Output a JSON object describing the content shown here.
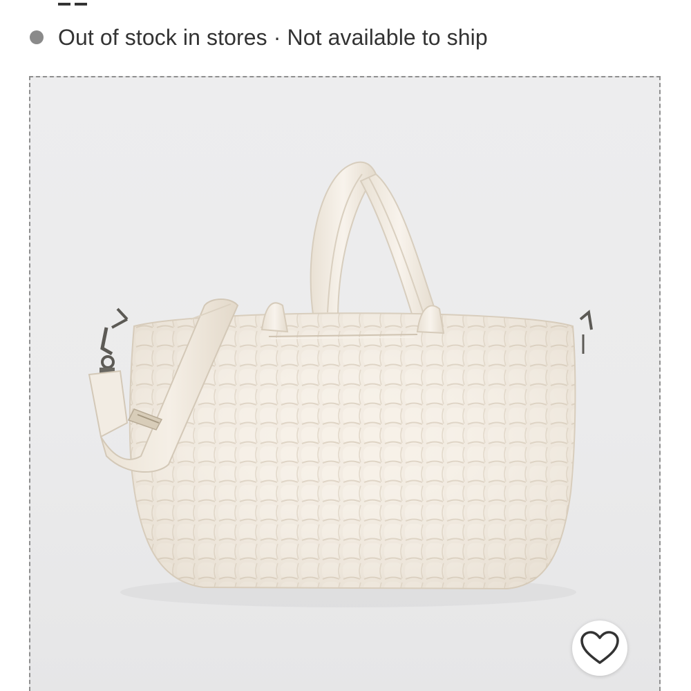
{
  "availability": {
    "status_text": "Out of stock in stores · Not available to ship",
    "status_color": "#8a8a8a"
  },
  "product_image": {
    "alt": "Quilted puffer tote bag in cream with padded handles and crossbody strap"
  },
  "favorite": {
    "icon": "heart-outline-icon",
    "aria_label": "favorite"
  }
}
